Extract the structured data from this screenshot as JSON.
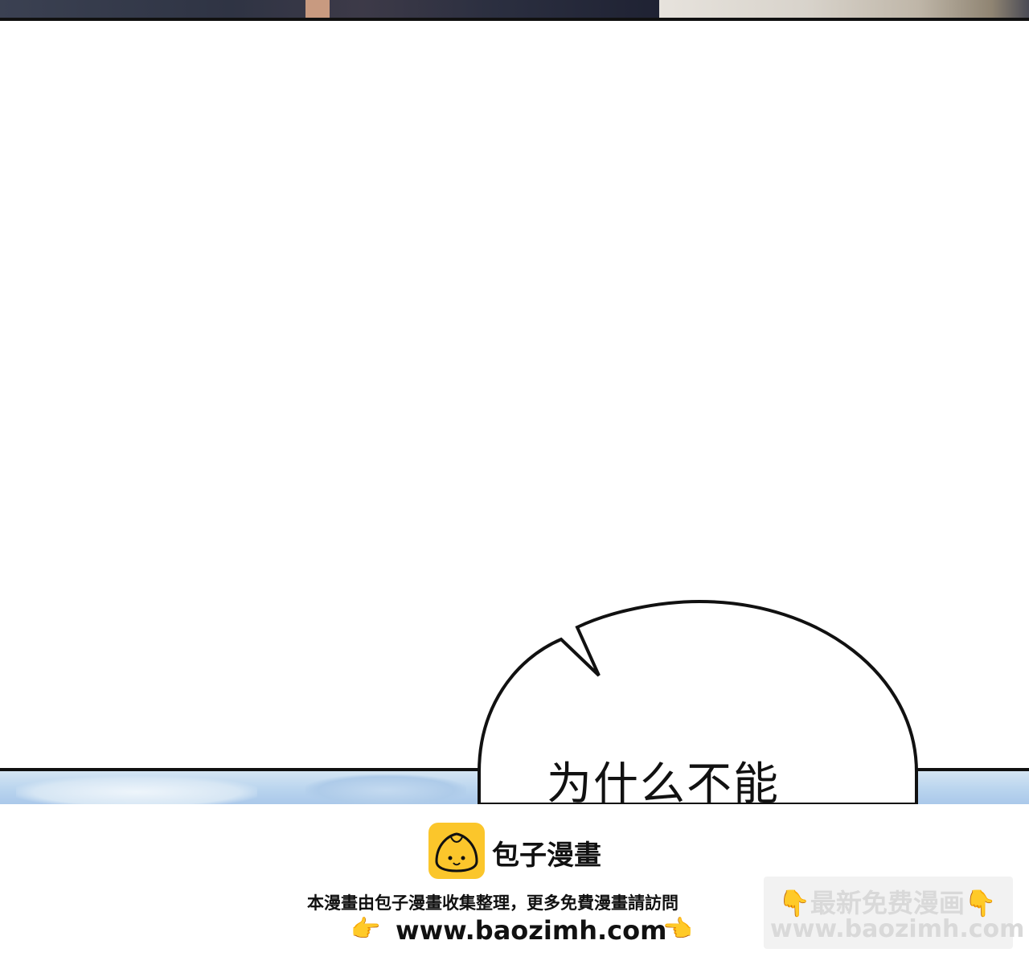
{
  "bubble": {
    "text": "为什么不能看？"
  },
  "footer": {
    "brand_name": "包子漫畫",
    "notice": "本漫畫由包子漫畫收集整理，更多免費漫畫請訪問",
    "url": "www.baozimh.com",
    "hand_left": "👉",
    "hand_right": "👈"
  },
  "watermark": {
    "title": "👇最新免费漫画👇",
    "url": "www.baozimh.com"
  },
  "colors": {
    "logo_bg": "#fbc62b",
    "text": "#111111",
    "watermark_text": "#d9d9d9",
    "sky": "#b9d4ee"
  },
  "icons": {
    "logo": "bun-face-icon"
  }
}
